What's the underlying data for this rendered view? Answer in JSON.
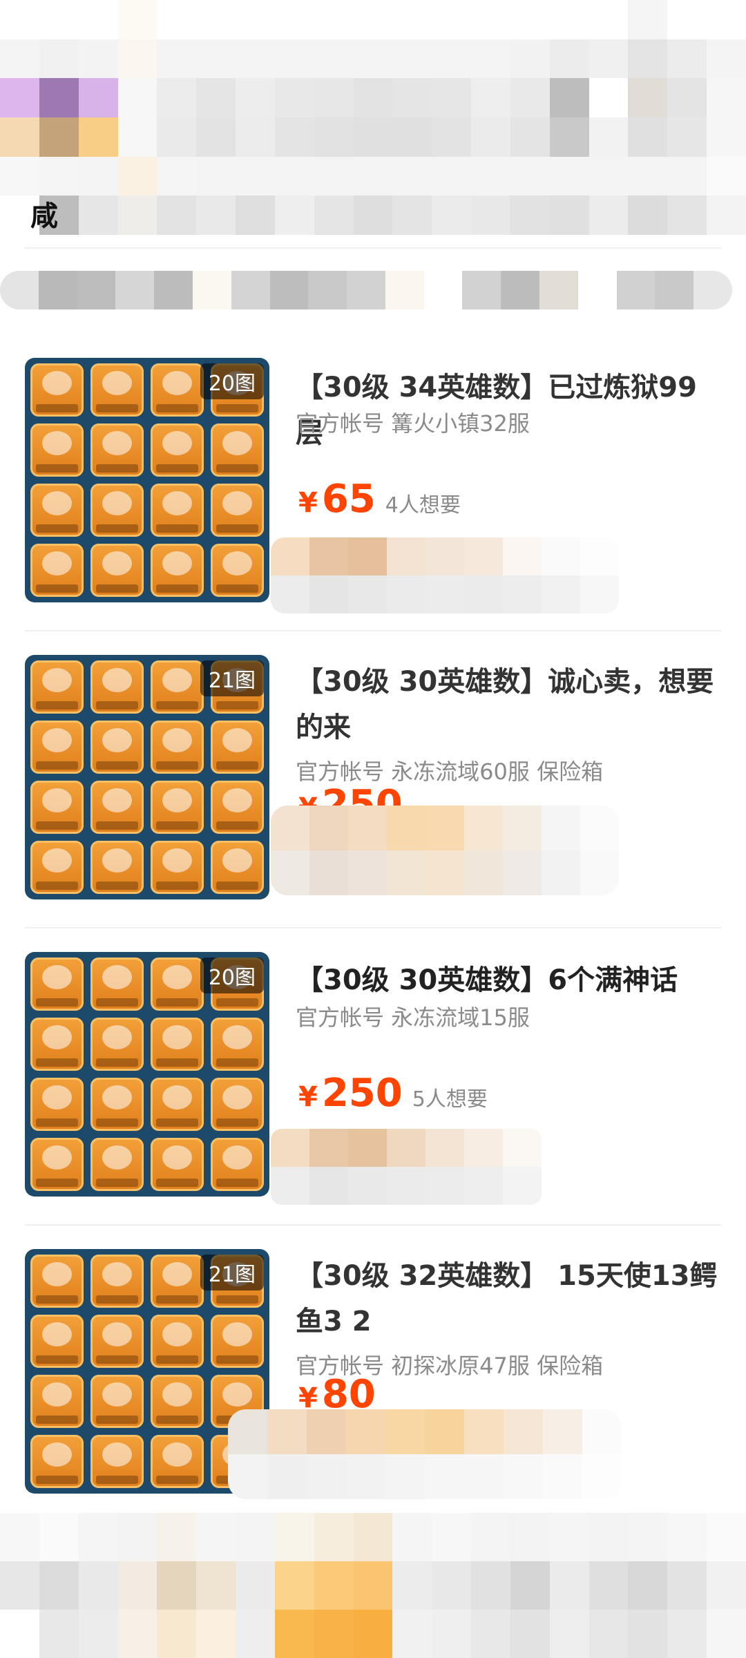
{
  "header": {
    "partial_text": "咸"
  },
  "listings": [
    {
      "title": "【30级 34英雄数】已过炼狱99层",
      "meta": "官方帐号 篝火小镇32服",
      "price_symbol": "¥",
      "price": "65",
      "want": "4人想要",
      "image_count": "20图"
    },
    {
      "title": "【30级 30英雄数】诚心卖，想要的来",
      "meta": "官方帐号 永冻流域60服 保险箱",
      "price_symbol": "¥",
      "price": "250",
      "want": "",
      "image_count": "21图"
    },
    {
      "title": "【30级 30英雄数】6个满神话",
      "meta": "官方帐号 永冻流域15服",
      "price_symbol": "¥",
      "price": "250",
      "want": "5人想要",
      "image_count": "20图"
    },
    {
      "title": "【30级 32英雄数】 15天使13鳄鱼3 2",
      "meta": "官方帐号 初探冰原47服 保险箱",
      "price_symbol": "¥",
      "price": "80",
      "want": "",
      "image_count": "21图"
    }
  ],
  "colors": {
    "price": "#ff4400",
    "title": "#333333",
    "meta": "#8a8a8a",
    "divider": "#eeeeee"
  }
}
